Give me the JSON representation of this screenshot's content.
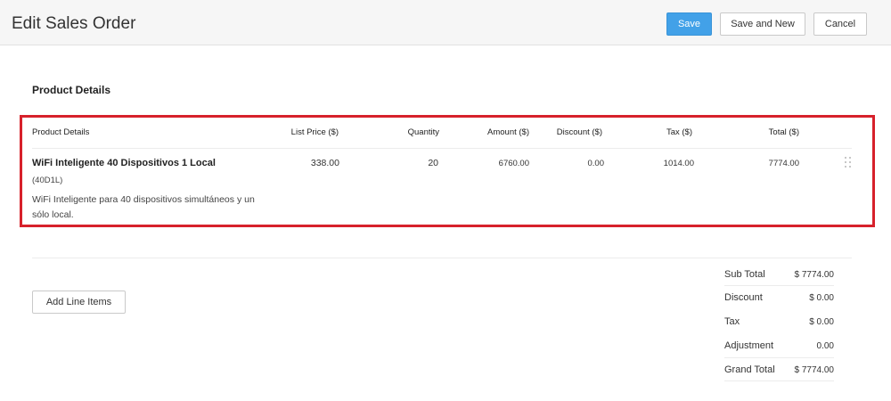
{
  "header": {
    "title": "Edit Sales Order",
    "save_label": "Save",
    "save_new_label": "Save and New",
    "cancel_label": "Cancel"
  },
  "section": {
    "title": "Product Details"
  },
  "table": {
    "columns": [
      "Product Details",
      "List Price ($)",
      "Quantity",
      "Amount ($)",
      "Discount ($)",
      "Tax ($)",
      "Total ($)"
    ],
    "rows": [
      {
        "name": "WiFi Inteligente 40 Dispositivos 1 Local",
        "code": "(40D1L)",
        "description": "WiFi Inteligente para 40 dispositivos simultáneos y un sólo local.",
        "list_price": "338.00",
        "quantity": "20",
        "amount": "6760.00",
        "discount": "0.00",
        "tax": "1014.00",
        "total": "7774.00"
      }
    ]
  },
  "add_line_items_label": "Add Line Items",
  "summary": {
    "sub_total": {
      "label": "Sub Total",
      "value": "$ 7774.00"
    },
    "discount": {
      "label": "Discount",
      "value": "$ 0.00"
    },
    "tax": {
      "label": "Tax",
      "value": "$ 0.00"
    },
    "adjustment": {
      "label": "Adjustment",
      "value": "0.00"
    },
    "grand_total": {
      "label": "Grand Total",
      "value": "$ 7774.00"
    }
  },
  "colors": {
    "primary": "#42a1e8",
    "highlight": "#d7212b"
  },
  "icons": {
    "row_handle": "drag-handle-icon"
  }
}
